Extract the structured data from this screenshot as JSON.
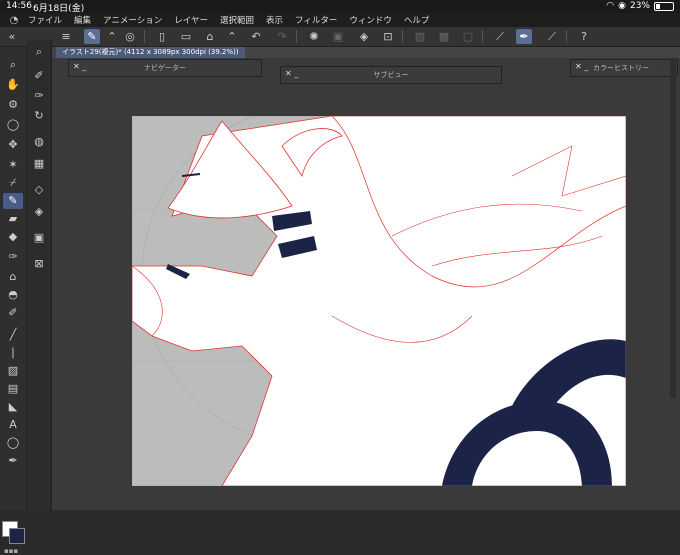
{
  "status": {
    "time": "14:56",
    "date": "6月18日(金)",
    "battery": "23%",
    "battery_level": 0.23
  },
  "menu": [
    "ファイル",
    "編集",
    "アニメーション",
    "レイヤー",
    "選択範囲",
    "表示",
    "フィルター",
    "ウィンドウ",
    "ヘルプ"
  ],
  "document": {
    "tab_title": "イラスト29(複元)* (4112 x 3089px 300dpi (39.2%))"
  },
  "panels": {
    "navigator": "ナビゲーター",
    "subview": "サブビュー",
    "color_history": "カラーヒストリー"
  },
  "icons": {
    "app_logo": "◔",
    "menu": "≡",
    "close": "✕",
    "minimize": "_",
    "tool": "✎",
    "undo": "↶",
    "redo": "↷"
  },
  "colors": {
    "accent": "#5a6f95",
    "ink": "#1b2447",
    "line": "#e0332d",
    "canvas_gray": "#bcbcbc",
    "white": "#ffffff"
  }
}
